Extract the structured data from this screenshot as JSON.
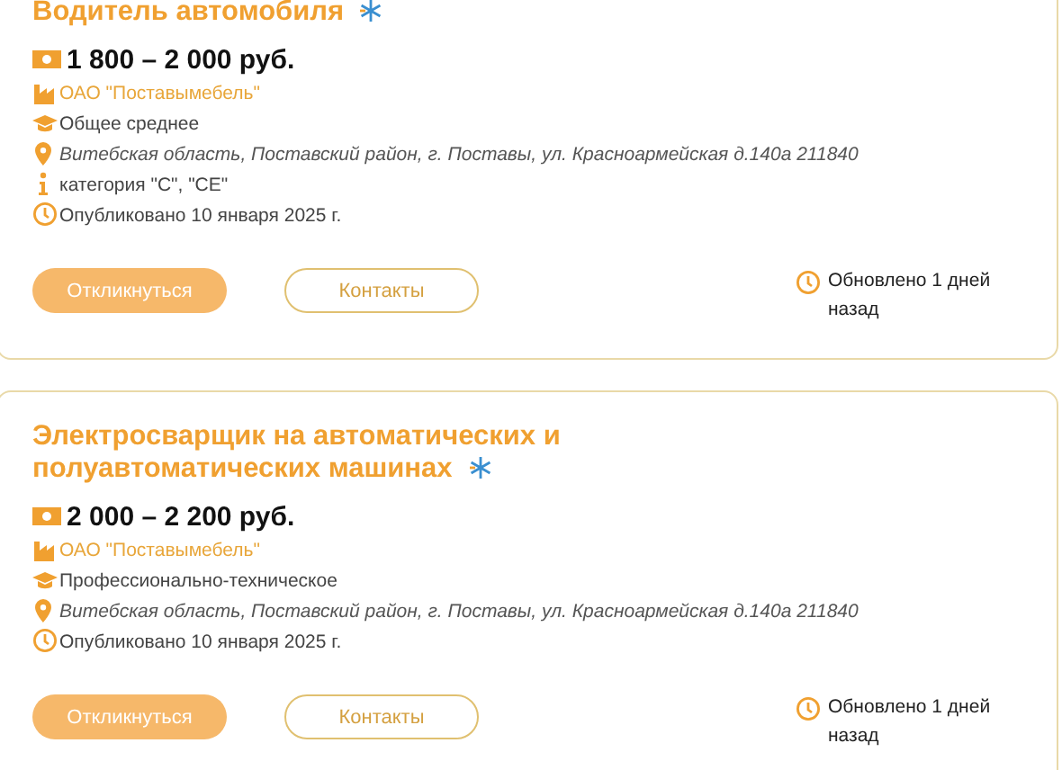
{
  "vacancies": [
    {
      "title": "Водитель автомобиля",
      "salary": "1 800 – 2 000 руб.",
      "details": [
        {
          "kind": "company",
          "text": "ОАО \"Поставымебель\""
        },
        {
          "kind": "education",
          "text": "Общее среднее"
        },
        {
          "kind": "address",
          "text": "Витебская область, Поставский район, г. Поставы, ул. Красноармейская д.140а 211840"
        },
        {
          "kind": "info",
          "text": "категория \"C\", \"CE\""
        },
        {
          "kind": "published",
          "text": "Опубликовано 10 января 2025 г."
        }
      ],
      "buttons": [
        {
          "kind": "primary",
          "label": "Откликнуться"
        },
        {
          "kind": "outline",
          "label": "Контакты"
        }
      ],
      "updated": "Обновлено 1 дней назад"
    },
    {
      "title": "Электросварщик на автоматических и полуавтоматических машинах",
      "salary": "2 000 – 2 200 руб.",
      "details": [
        {
          "kind": "company",
          "text": "ОАО \"Поставымебель\""
        },
        {
          "kind": "education",
          "text": "Профессионально-техническое"
        },
        {
          "kind": "address",
          "text": "Витебская область, Поставский район, г. Поставы, ул. Красноармейская д.140а 211840"
        },
        {
          "kind": "published",
          "text": "Опубликовано 10 января 2025 г."
        }
      ],
      "buttons": [
        {
          "kind": "primary",
          "label": "Откликнуться"
        },
        {
          "kind": "outline",
          "label": "Контакты"
        }
      ],
      "updated": "Обновлено 1 дней назад"
    }
  ]
}
